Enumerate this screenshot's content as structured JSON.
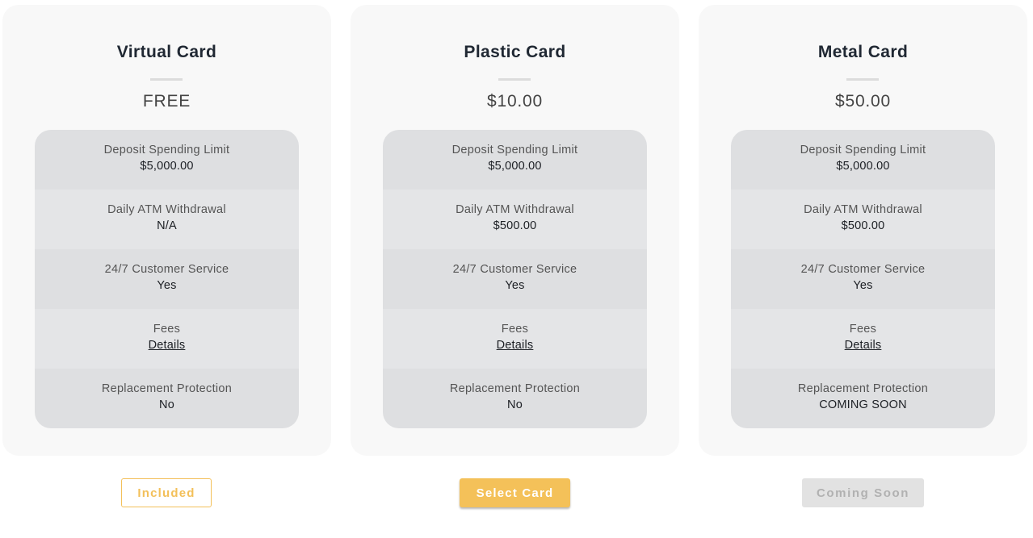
{
  "plans": [
    {
      "title": "Virtual Card",
      "price": "FREE",
      "features": [
        {
          "label": "Deposit Spending Limit",
          "value": "$5,000.00"
        },
        {
          "label": "Daily ATM Withdrawal",
          "value": "N/A"
        },
        {
          "label": "24/7 Customer Service",
          "value": "Yes"
        },
        {
          "label": "Fees",
          "value": "Details"
        },
        {
          "label": "Replacement Protection",
          "value": "No"
        }
      ],
      "button": {
        "label": "Included",
        "state": "included"
      }
    },
    {
      "title": "Plastic Card",
      "price": "$10.00",
      "features": [
        {
          "label": "Deposit Spending Limit",
          "value": "$5,000.00"
        },
        {
          "label": "Daily ATM Withdrawal",
          "value": "$500.00"
        },
        {
          "label": "24/7 Customer Service",
          "value": "Yes"
        },
        {
          "label": "Fees",
          "value": "Details"
        },
        {
          "label": "Replacement Protection",
          "value": "No"
        }
      ],
      "button": {
        "label": "Select Card",
        "state": "available"
      }
    },
    {
      "title": "Metal Card",
      "price": "$50.00",
      "features": [
        {
          "label": "Deposit Spending Limit",
          "value": "$5,000.00"
        },
        {
          "label": "Daily ATM Withdrawal",
          "value": "$500.00"
        },
        {
          "label": "24/7 Customer Service",
          "value": "Yes"
        },
        {
          "label": "Fees",
          "value": "Details"
        },
        {
          "label": "Replacement Protection",
          "value": "COMING SOON"
        }
      ],
      "button": {
        "label": "Coming Soon",
        "state": "disabled"
      }
    }
  ],
  "colors": {
    "accent": "#f4c159",
    "card_background": "#f8f8f8",
    "feature_row_dark": "#dedfe1",
    "feature_row_light": "#e4e5e7",
    "disabled_button": "#e2e2e2"
  }
}
